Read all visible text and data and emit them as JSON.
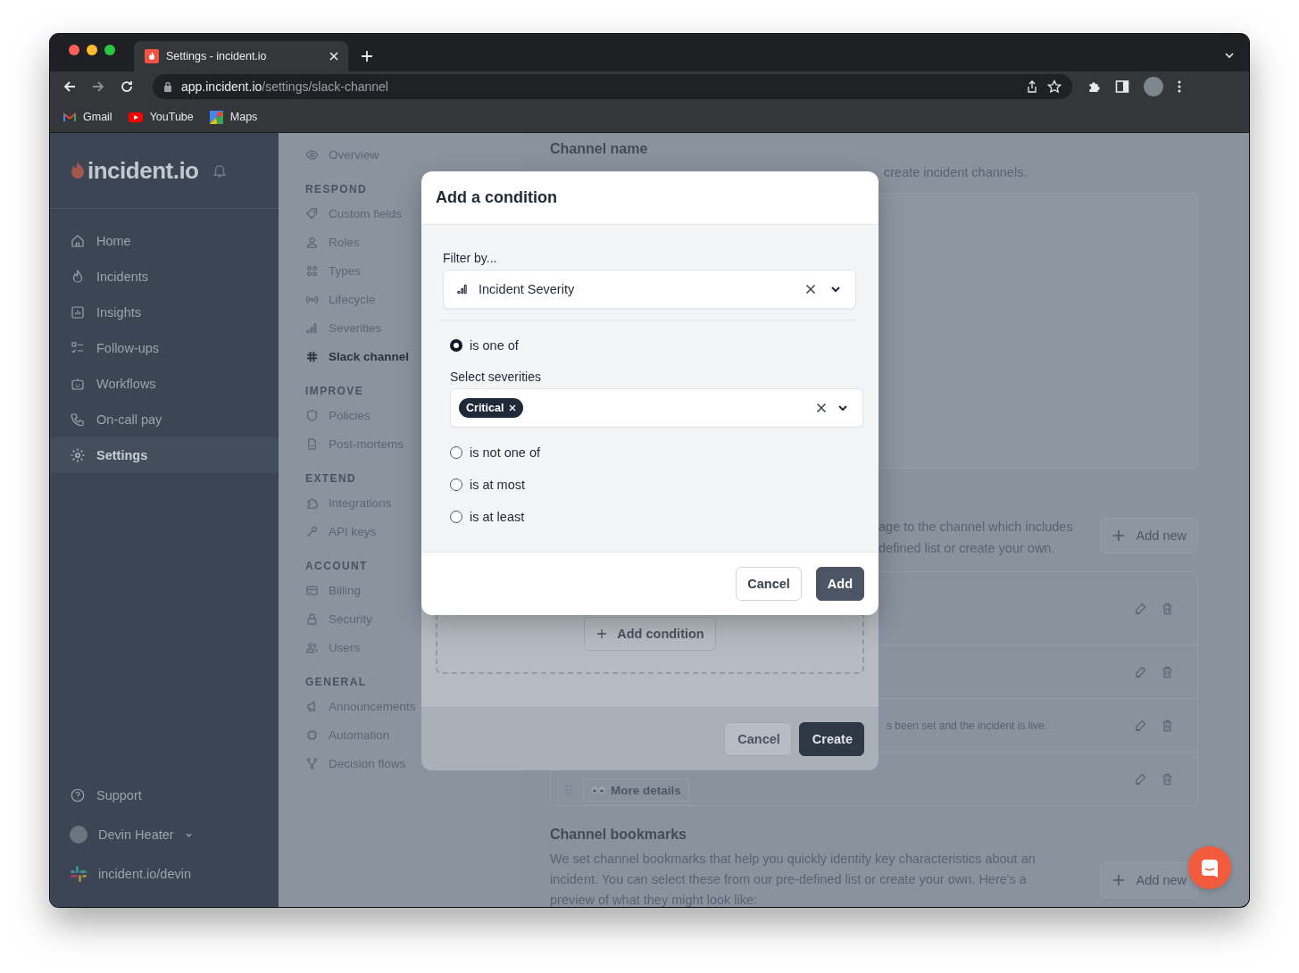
{
  "browser": {
    "tab": {
      "title": "Settings - incident.io"
    },
    "url": {
      "host": "app.incident.io",
      "path": "/settings/slack-channel"
    },
    "bookmarks": [
      {
        "label": "Gmail",
        "kind": "gmail"
      },
      {
        "label": "YouTube",
        "kind": "youtube"
      },
      {
        "label": "Maps",
        "kind": "maps"
      }
    ]
  },
  "sidebar": {
    "logo": "incident.io",
    "items": [
      {
        "label": "Home",
        "kind": "home",
        "selected": false
      },
      {
        "label": "Incidents",
        "kind": "incidents",
        "selected": false
      },
      {
        "label": "Insights",
        "kind": "insights",
        "selected": false
      },
      {
        "label": "Follow-ups",
        "kind": "followups",
        "selected": false
      },
      {
        "label": "Workflows",
        "kind": "workflows",
        "selected": false
      },
      {
        "label": "On-call pay",
        "kind": "oncall",
        "selected": false
      },
      {
        "label": "Settings",
        "kind": "settings",
        "selected": true
      }
    ],
    "footer": {
      "support": "Support",
      "user": "Devin Heater",
      "workspace": "incident.io/devin"
    }
  },
  "settings_nav": {
    "items": [
      {
        "label": "Overview",
        "kind": "overview",
        "selected": false
      }
    ],
    "sections": [
      {
        "title": "RESPOND",
        "items": [
          {
            "label": "Custom fields",
            "kind": "tag",
            "selected": false
          },
          {
            "label": "Roles",
            "kind": "person",
            "selected": false
          },
          {
            "label": "Types",
            "kind": "grid",
            "selected": false
          },
          {
            "label": "Lifecycle",
            "kind": "signal",
            "selected": false
          },
          {
            "label": "Severities",
            "kind": "bars",
            "selected": false
          },
          {
            "label": "Slack channel",
            "kind": "slack",
            "selected": true
          }
        ]
      },
      {
        "title": "IMPROVE",
        "items": [
          {
            "label": "Policies",
            "kind": "shield",
            "selected": false
          },
          {
            "label": "Post-mortems",
            "kind": "document",
            "selected": false
          }
        ]
      },
      {
        "title": "EXTEND",
        "items": [
          {
            "label": "Integrations",
            "kind": "puzzle",
            "selected": false
          },
          {
            "label": "API keys",
            "kind": "key",
            "selected": false
          }
        ]
      },
      {
        "title": "ACCOUNT",
        "items": [
          {
            "label": "Billing",
            "kind": "card",
            "selected": false
          },
          {
            "label": "Security",
            "kind": "lock",
            "selected": false
          },
          {
            "label": "Users",
            "kind": "people",
            "selected": false
          }
        ]
      },
      {
        "title": "GENERAL",
        "items": [
          {
            "label": "Announcements",
            "kind": "megaphone",
            "selected": false
          },
          {
            "label": "Automation",
            "kind": "chip",
            "selected": false
          },
          {
            "label": "Decision flows",
            "kind": "flow",
            "selected": false
          }
        ]
      }
    ]
  },
  "main": {
    "channel_name": {
      "title": "Channel name",
      "description": "create incident channels."
    },
    "messages": {
      "description_lines": [
        "age to the channel which includes",
        "defined list or create your own."
      ],
      "add_button": "Add new",
      "rows": [
        {
          "kind": "blank"
        },
        {
          "kind": "blank"
        },
        {
          "kind": "text",
          "text": "s been set and the incident is live."
        },
        {
          "kind": "chip",
          "text": "More details"
        }
      ]
    },
    "bookmarks": {
      "title": "Channel bookmarks",
      "description": "We set channel bookmarks that help you quickly identify key characteristics about an incident. You can select these from our pre-defined list or create your own. Here's a preview of what they might look like:",
      "add_button": "Add new"
    }
  },
  "create_dialog": {
    "add_condition_button": "Add condition",
    "buttons": [
      {
        "label": "Cancel",
        "kind": "secondary"
      },
      {
        "label": "Create",
        "kind": "primary"
      }
    ]
  },
  "condition_dialog": {
    "title": "Add a condition",
    "filter": {
      "label": "Filter by...",
      "value": "Incident Severity"
    },
    "options": [
      {
        "label": "is one of",
        "selected": true
      },
      {
        "label": "is not one of",
        "selected": false
      },
      {
        "label": "is at most",
        "selected": false
      },
      {
        "label": "is at least",
        "selected": false
      }
    ],
    "severities": {
      "label": "Select severities",
      "chips": [
        "Critical"
      ]
    },
    "buttons": [
      {
        "label": "Cancel",
        "kind": "secondary"
      },
      {
        "label": "Add",
        "kind": "primary"
      }
    ]
  }
}
